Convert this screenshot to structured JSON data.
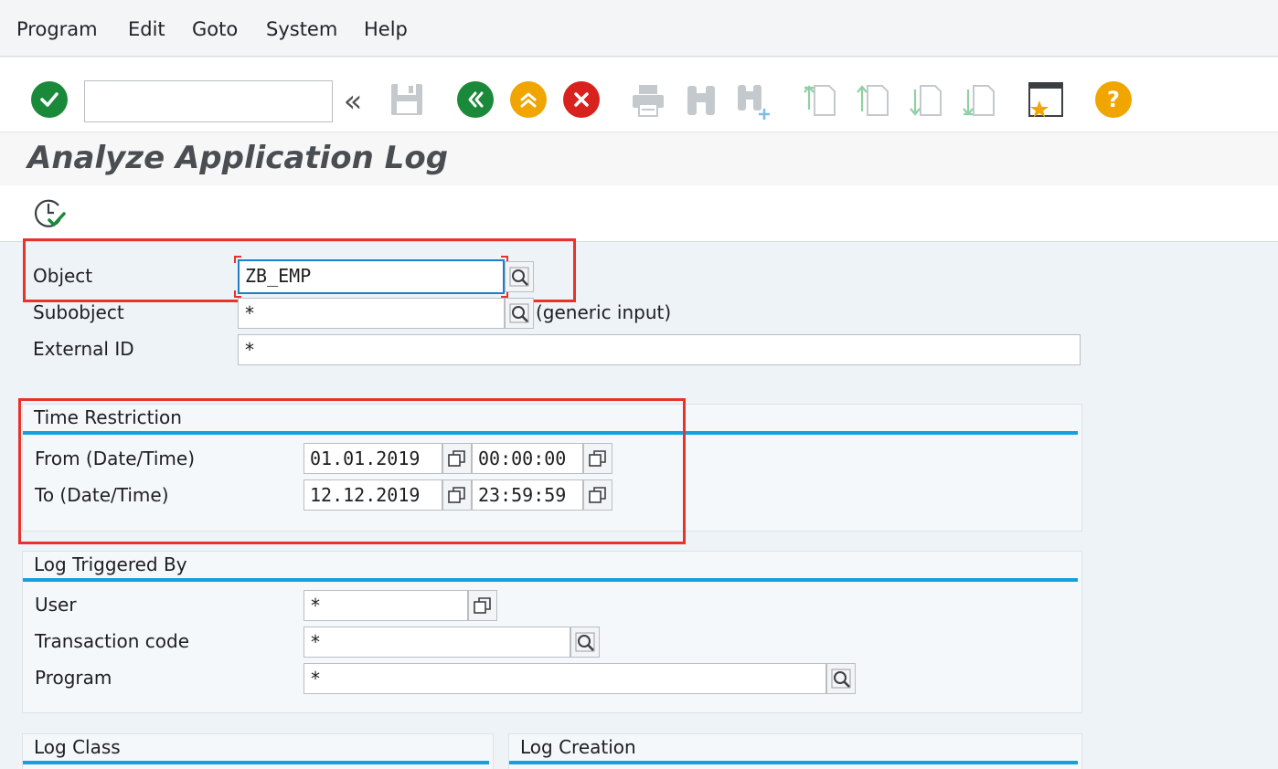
{
  "menubar": {
    "items": [
      "Program",
      "Edit",
      "Goto",
      "System",
      "Help"
    ]
  },
  "toolbar": {
    "command_field_value": "",
    "icons": [
      "enter-icon",
      "back-arrows-icon",
      "save-icon",
      "back-icon",
      "exit-icon",
      "cancel-icon",
      "print-icon",
      "find-icon",
      "find-next-icon",
      "first-page-icon",
      "previous-page-icon",
      "next-page-icon",
      "last-page-icon",
      "create-shortcut-icon",
      "help-icon"
    ],
    "colors": {
      "enter": "#1a8a3a",
      "back": "#1a8a3a",
      "exit": "#f0a500",
      "cancel": "#d9211e",
      "help": "#f0a500",
      "disabled": "#c4c9ce"
    }
  },
  "page": {
    "title": "Analyze Application Log"
  },
  "form": {
    "object": {
      "label": "Object",
      "value": "ZB_EMP"
    },
    "subobject": {
      "label": "Subobject",
      "value": "*",
      "hint": "(generic input)"
    },
    "external_id": {
      "label": "External ID",
      "value": "*"
    }
  },
  "time_restriction": {
    "title": "Time Restriction",
    "from": {
      "label": "From (Date/Time)",
      "date": "01.01.2019",
      "time": "00:00:00"
    },
    "to": {
      "label": "To (Date/Time)",
      "date": "12.12.2019",
      "time": "23:59:59"
    }
  },
  "triggered_by": {
    "title": "Log Triggered By",
    "user": {
      "label": "User",
      "value": "*"
    },
    "tcode": {
      "label": "Transaction code",
      "value": "*"
    },
    "program": {
      "label": "Program",
      "value": "*"
    }
  },
  "log_class": {
    "title": "Log Class"
  },
  "log_creation": {
    "title": "Log Creation"
  },
  "accent_color": "#12a0e0",
  "highlight_color": "#e8332b"
}
